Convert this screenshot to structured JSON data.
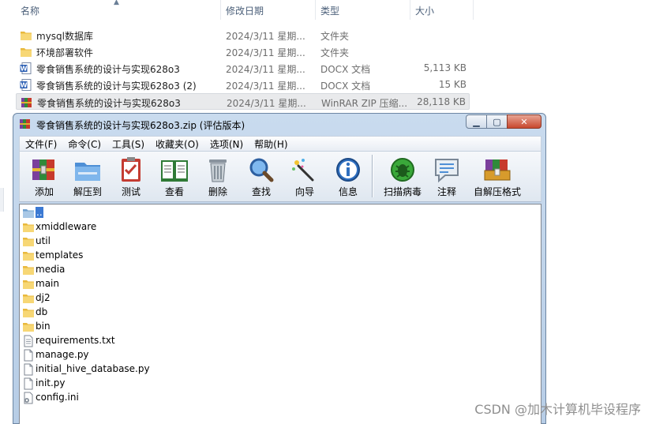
{
  "explorer": {
    "columns": {
      "name": "名称",
      "date": "修改日期",
      "type": "类型",
      "size": "大小"
    },
    "rows": [
      {
        "icon": "folder-icon",
        "name": "mysql数据库",
        "date": "2024/3/11 星期...",
        "type": "文件夹",
        "size": ""
      },
      {
        "icon": "folder-icon",
        "name": "环境部署软件",
        "date": "2024/3/11 星期...",
        "type": "文件夹",
        "size": ""
      },
      {
        "icon": "word-doc-icon",
        "name": "零食销售系统的设计与实现628o3",
        "date": "2024/3/11 星期...",
        "type": "DOCX 文档",
        "size": "5,113 KB"
      },
      {
        "icon": "word-doc-icon",
        "name": "零食销售系统的设计与实现628o3 (2)",
        "date": "2024/3/11 星期...",
        "type": "DOCX 文档",
        "size": "15 KB"
      },
      {
        "icon": "winrar-archive-icon",
        "name": "零食销售系统的设计与实现628o3",
        "date": "2024/3/11 星期...",
        "type": "WinRAR ZIP 压缩...",
        "size": "28,118 KB"
      }
    ]
  },
  "rar": {
    "title": "零食销售系统的设计与实现628o3.zip (评估版本)",
    "menu": [
      "文件(F)",
      "命令(C)",
      "工具(S)",
      "收藏夹(O)",
      "选项(N)",
      "帮助(H)"
    ],
    "toolbar": [
      {
        "label": "添加",
        "icon": "add-books-icon"
      },
      {
        "label": "解压到",
        "icon": "extract-folder-icon"
      },
      {
        "label": "测试",
        "icon": "test-clipboard-icon"
      },
      {
        "label": "查看",
        "icon": "view-book-icon"
      },
      {
        "label": "删除",
        "icon": "trash-icon"
      },
      {
        "label": "查找",
        "icon": "magnifier-icon"
      },
      {
        "label": "向导",
        "icon": "wizard-wand-icon"
      },
      {
        "label": "信息",
        "icon": "info-icon"
      },
      {
        "label": "扫描病毒",
        "icon": "virus-scan-icon"
      },
      {
        "label": "注释",
        "icon": "comment-icon"
      },
      {
        "label": "自解压格式",
        "icon": "sfx-box-icon"
      }
    ],
    "files": [
      {
        "name": "..",
        "icon": "parent-folder-icon"
      },
      {
        "name": "xmiddleware",
        "icon": "folder-icon"
      },
      {
        "name": "util",
        "icon": "folder-icon"
      },
      {
        "name": "templates",
        "icon": "folder-icon"
      },
      {
        "name": "media",
        "icon": "folder-icon"
      },
      {
        "name": "main",
        "icon": "folder-icon"
      },
      {
        "name": "dj2",
        "icon": "folder-icon"
      },
      {
        "name": "db",
        "icon": "folder-icon"
      },
      {
        "name": "bin",
        "icon": "folder-icon"
      },
      {
        "name": "requirements.txt",
        "icon": "text-file-icon"
      },
      {
        "name": "manage.py",
        "icon": "file-icon"
      },
      {
        "name": "initial_hive_database.py",
        "icon": "file-icon"
      },
      {
        "name": "init.py",
        "icon": "file-icon"
      },
      {
        "name": "config.ini",
        "icon": "config-file-icon"
      }
    ]
  },
  "watermark": "CSDN @加木计算机毕设程序"
}
